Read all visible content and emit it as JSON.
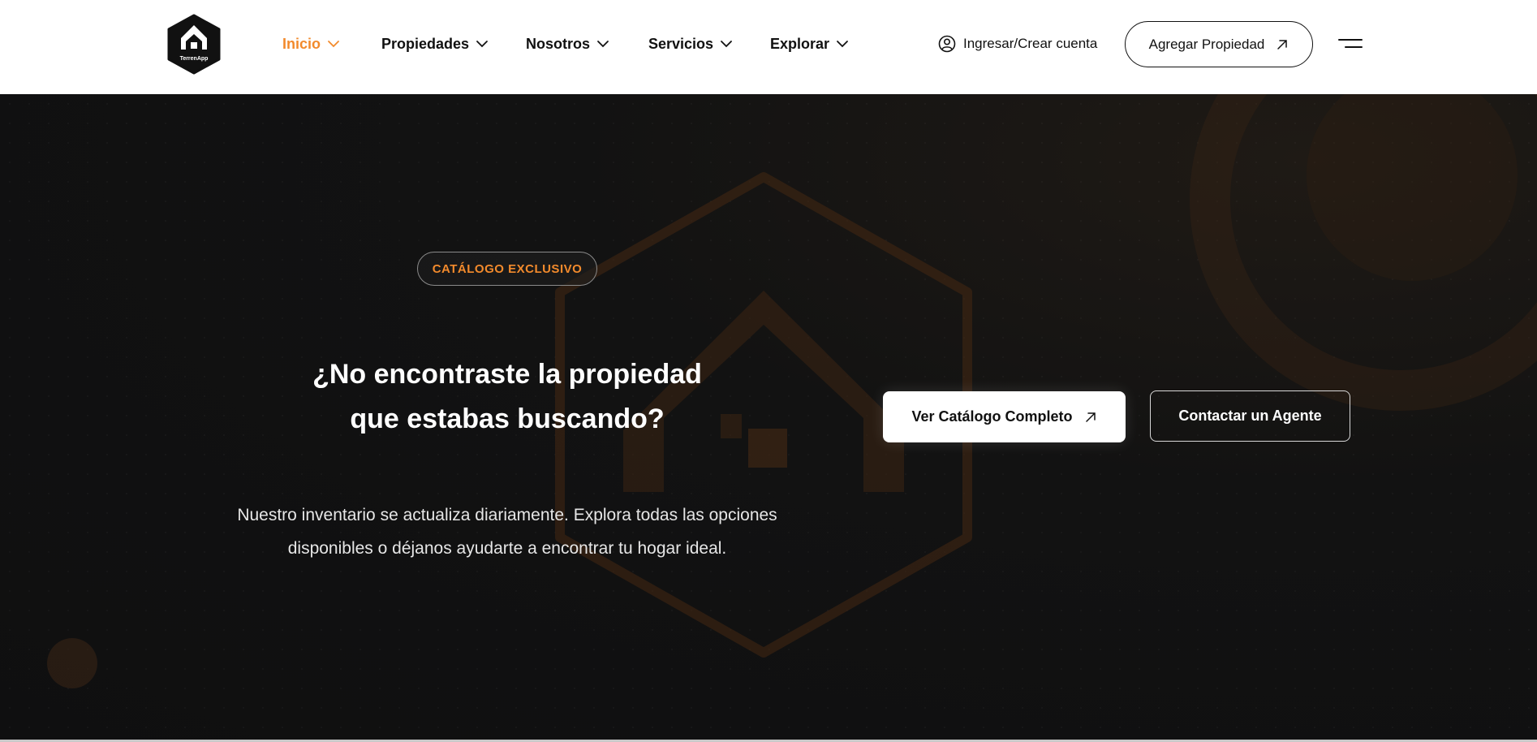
{
  "brand": {
    "logo_text": "TerrenApp",
    "accent_color": "#f28a2c",
    "dark_color": "#111111"
  },
  "nav": {
    "items": [
      {
        "label": "Inicio",
        "active": true,
        "icon": "chevron-down-icon"
      },
      {
        "label": "Propiedades",
        "active": false,
        "icon": "chevron-down-icon"
      },
      {
        "label": "Nosotros",
        "active": false,
        "icon": "chevron-down-icon"
      },
      {
        "label": "Servicios",
        "active": false,
        "icon": "chevron-down-icon"
      },
      {
        "label": "Explorar",
        "active": false,
        "icon": "chevron-down-icon"
      }
    ]
  },
  "header": {
    "login_label": "Ingresar/Crear cuenta",
    "login_icon": "user-circle-icon",
    "add_property_label": "Agregar Propiedad",
    "add_property_icon": "arrow-up-right-icon",
    "menu_icon": "hamburger-menu-icon"
  },
  "hero": {
    "badge": "CATÁLOGO EXCLUSIVO",
    "headline_line1": "¿No encontraste la propiedad",
    "headline_line2": "que estabas buscando?",
    "subtext_line1": "Nuestro inventario se actualiza diariamente. Explora todas las opciones",
    "subtext_line2": "disponibles o déjanos ayudarte a encontrar tu hogar ideal.",
    "catalog_button": "Ver Catálogo Completo",
    "catalog_icon": "arrow-up-right-icon",
    "agent_button": "Contactar un Agente",
    "background_icon": "house-hexagon-icon"
  }
}
